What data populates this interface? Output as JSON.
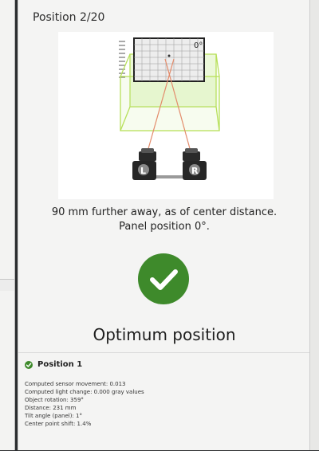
{
  "panel": {
    "position_label": "Position 2/20",
    "angle_label": "0°",
    "camera_left_label": "L",
    "camera_right_label": "R",
    "caption_line1": "90 mm further away, as of center distance.",
    "caption_line2": "Panel position 0°.",
    "status_text": "Optimum position"
  },
  "summary": {
    "title": "Position 1",
    "lines": [
      "Computed sensor movement: 0.013",
      "Computed light change: 0.000 gray values",
      "Object rotation: 359°",
      "Distance: 231 mm",
      "Tilt angle (panel): 1°",
      "Center point shift: 1.4%"
    ]
  },
  "colors": {
    "accent_green": "#3e8a2b",
    "box_outline": "#b7e05a",
    "ray": "#e38b6b"
  },
  "icons": {
    "status": "check-icon",
    "summary_status": "check-icon"
  }
}
